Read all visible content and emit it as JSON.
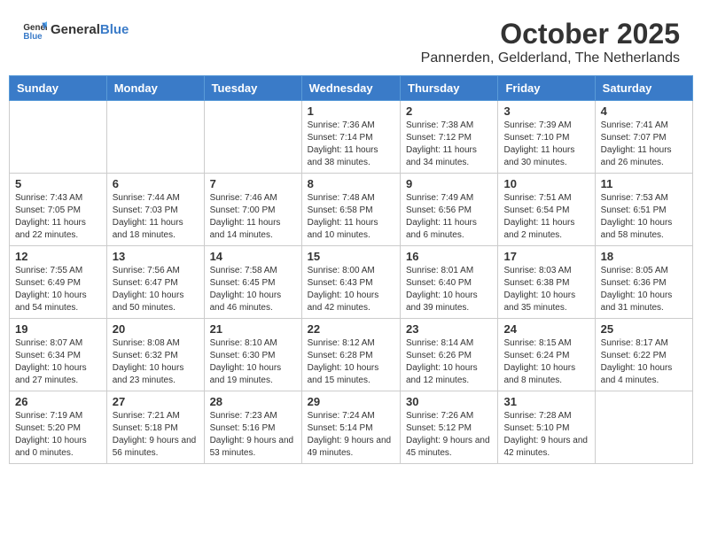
{
  "logo": {
    "text_general": "General",
    "text_blue": "Blue"
  },
  "title": "October 2025",
  "location": "Pannerden, Gelderland, The Netherlands",
  "days_of_week": [
    "Sunday",
    "Monday",
    "Tuesday",
    "Wednesday",
    "Thursday",
    "Friday",
    "Saturday"
  ],
  "weeks": [
    [
      {
        "day": "",
        "info": ""
      },
      {
        "day": "",
        "info": ""
      },
      {
        "day": "",
        "info": ""
      },
      {
        "day": "1",
        "info": "Sunrise: 7:36 AM\nSunset: 7:14 PM\nDaylight: 11 hours\nand 38 minutes."
      },
      {
        "day": "2",
        "info": "Sunrise: 7:38 AM\nSunset: 7:12 PM\nDaylight: 11 hours\nand 34 minutes."
      },
      {
        "day": "3",
        "info": "Sunrise: 7:39 AM\nSunset: 7:10 PM\nDaylight: 11 hours\nand 30 minutes."
      },
      {
        "day": "4",
        "info": "Sunrise: 7:41 AM\nSunset: 7:07 PM\nDaylight: 11 hours\nand 26 minutes."
      }
    ],
    [
      {
        "day": "5",
        "info": "Sunrise: 7:43 AM\nSunset: 7:05 PM\nDaylight: 11 hours\nand 22 minutes."
      },
      {
        "day": "6",
        "info": "Sunrise: 7:44 AM\nSunset: 7:03 PM\nDaylight: 11 hours\nand 18 minutes."
      },
      {
        "day": "7",
        "info": "Sunrise: 7:46 AM\nSunset: 7:00 PM\nDaylight: 11 hours\nand 14 minutes."
      },
      {
        "day": "8",
        "info": "Sunrise: 7:48 AM\nSunset: 6:58 PM\nDaylight: 11 hours\nand 10 minutes."
      },
      {
        "day": "9",
        "info": "Sunrise: 7:49 AM\nSunset: 6:56 PM\nDaylight: 11 hours\nand 6 minutes."
      },
      {
        "day": "10",
        "info": "Sunrise: 7:51 AM\nSunset: 6:54 PM\nDaylight: 11 hours\nand 2 minutes."
      },
      {
        "day": "11",
        "info": "Sunrise: 7:53 AM\nSunset: 6:51 PM\nDaylight: 10 hours\nand 58 minutes."
      }
    ],
    [
      {
        "day": "12",
        "info": "Sunrise: 7:55 AM\nSunset: 6:49 PM\nDaylight: 10 hours\nand 54 minutes."
      },
      {
        "day": "13",
        "info": "Sunrise: 7:56 AM\nSunset: 6:47 PM\nDaylight: 10 hours\nand 50 minutes."
      },
      {
        "day": "14",
        "info": "Sunrise: 7:58 AM\nSunset: 6:45 PM\nDaylight: 10 hours\nand 46 minutes."
      },
      {
        "day": "15",
        "info": "Sunrise: 8:00 AM\nSunset: 6:43 PM\nDaylight: 10 hours\nand 42 minutes."
      },
      {
        "day": "16",
        "info": "Sunrise: 8:01 AM\nSunset: 6:40 PM\nDaylight: 10 hours\nand 39 minutes."
      },
      {
        "day": "17",
        "info": "Sunrise: 8:03 AM\nSunset: 6:38 PM\nDaylight: 10 hours\nand 35 minutes."
      },
      {
        "day": "18",
        "info": "Sunrise: 8:05 AM\nSunset: 6:36 PM\nDaylight: 10 hours\nand 31 minutes."
      }
    ],
    [
      {
        "day": "19",
        "info": "Sunrise: 8:07 AM\nSunset: 6:34 PM\nDaylight: 10 hours\nand 27 minutes."
      },
      {
        "day": "20",
        "info": "Sunrise: 8:08 AM\nSunset: 6:32 PM\nDaylight: 10 hours\nand 23 minutes."
      },
      {
        "day": "21",
        "info": "Sunrise: 8:10 AM\nSunset: 6:30 PM\nDaylight: 10 hours\nand 19 minutes."
      },
      {
        "day": "22",
        "info": "Sunrise: 8:12 AM\nSunset: 6:28 PM\nDaylight: 10 hours\nand 15 minutes."
      },
      {
        "day": "23",
        "info": "Sunrise: 8:14 AM\nSunset: 6:26 PM\nDaylight: 10 hours\nand 12 minutes."
      },
      {
        "day": "24",
        "info": "Sunrise: 8:15 AM\nSunset: 6:24 PM\nDaylight: 10 hours\nand 8 minutes."
      },
      {
        "day": "25",
        "info": "Sunrise: 8:17 AM\nSunset: 6:22 PM\nDaylight: 10 hours\nand 4 minutes."
      }
    ],
    [
      {
        "day": "26",
        "info": "Sunrise: 7:19 AM\nSunset: 5:20 PM\nDaylight: 10 hours\nand 0 minutes."
      },
      {
        "day": "27",
        "info": "Sunrise: 7:21 AM\nSunset: 5:18 PM\nDaylight: 9 hours\nand 56 minutes."
      },
      {
        "day": "28",
        "info": "Sunrise: 7:23 AM\nSunset: 5:16 PM\nDaylight: 9 hours\nand 53 minutes."
      },
      {
        "day": "29",
        "info": "Sunrise: 7:24 AM\nSunset: 5:14 PM\nDaylight: 9 hours\nand 49 minutes."
      },
      {
        "day": "30",
        "info": "Sunrise: 7:26 AM\nSunset: 5:12 PM\nDaylight: 9 hours\nand 45 minutes."
      },
      {
        "day": "31",
        "info": "Sunrise: 7:28 AM\nSunset: 5:10 PM\nDaylight: 9 hours\nand 42 minutes."
      },
      {
        "day": "",
        "info": ""
      }
    ]
  ]
}
